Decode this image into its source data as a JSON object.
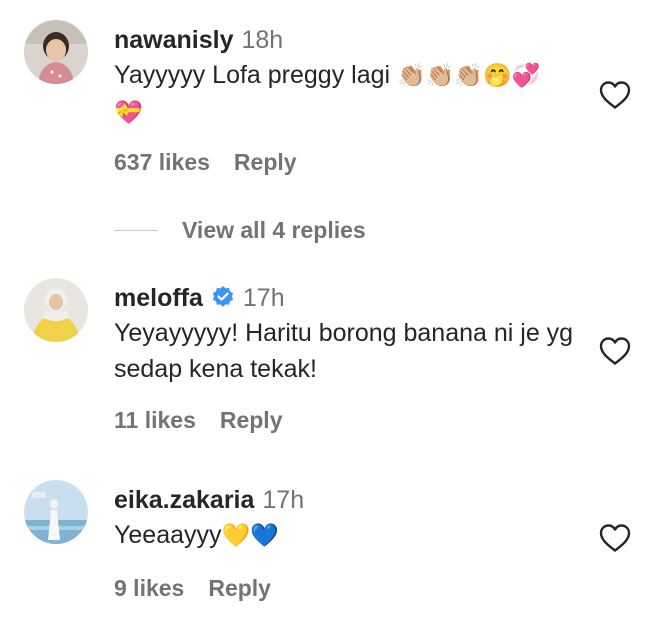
{
  "comments": [
    {
      "username": "nawanisly",
      "time": "18h",
      "text": "Yayyyyy Lofa preggy lagi",
      "emojis": "👏🏼👏🏼👏🏼🤭💞",
      "emojis_line2": "💝",
      "likes": "637 likes",
      "reply": "Reply",
      "verified": false
    },
    {
      "username": "meloffa",
      "time": "17h",
      "text": "Yeyayyyyy! Haritu borong banana ni je yg sedap kena tekak!",
      "likes": "11 likes",
      "reply": "Reply",
      "verified": true
    },
    {
      "username": "eika.zakaria",
      "time": "17h",
      "text": "Yeeaayyy",
      "emojis": "💛💙",
      "likes": "9 likes",
      "reply": "Reply",
      "verified": false
    }
  ],
  "view_replies": {
    "label": "View all 4 replies"
  },
  "icons": {
    "like": "heart-outline-icon",
    "verified": "verified-badge-icon"
  },
  "colors": {
    "text": "#262626",
    "secondary": "#737373",
    "verified": "#3897f0",
    "divider": "#c7c7c7"
  }
}
